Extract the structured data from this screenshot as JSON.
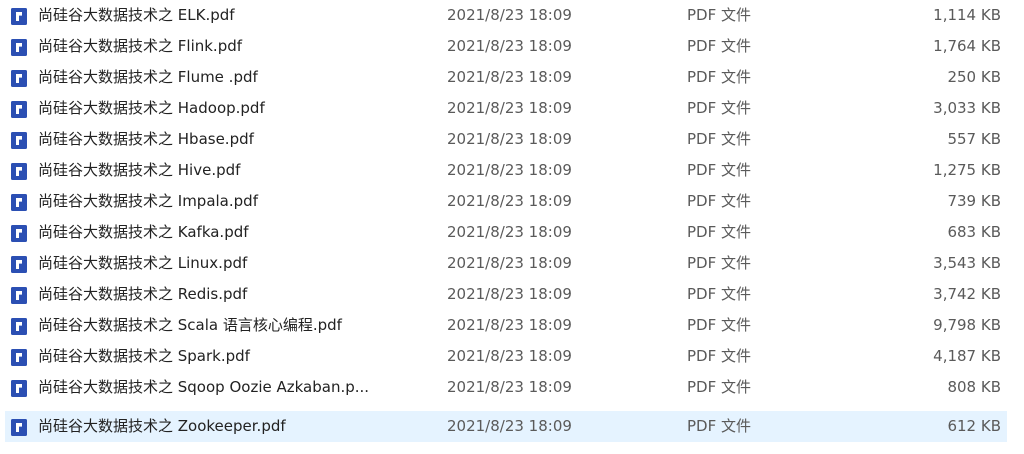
{
  "files": [
    {
      "name": "尚硅谷大数据技术之 ELK.pdf",
      "modified": "2021/8/23 18:09",
      "type": "PDF 文件",
      "size": "1,114 KB",
      "icon": "pdf-file-icon",
      "selected": false
    },
    {
      "name": "尚硅谷大数据技术之 Flink.pdf",
      "modified": "2021/8/23 18:09",
      "type": "PDF 文件",
      "size": "1,764 KB",
      "icon": "pdf-file-icon",
      "selected": false
    },
    {
      "name": "尚硅谷大数据技术之 Flume .pdf",
      "modified": "2021/8/23 18:09",
      "type": "PDF 文件",
      "size": "250 KB",
      "icon": "pdf-file-icon",
      "selected": false
    },
    {
      "name": "尚硅谷大数据技术之 Hadoop.pdf",
      "modified": "2021/8/23 18:09",
      "type": "PDF 文件",
      "size": "3,033 KB",
      "icon": "pdf-file-icon",
      "selected": false
    },
    {
      "name": "尚硅谷大数据技术之 Hbase.pdf",
      "modified": "2021/8/23 18:09",
      "type": "PDF 文件",
      "size": "557 KB",
      "icon": "pdf-file-icon",
      "selected": false
    },
    {
      "name": "尚硅谷大数据技术之 Hive.pdf",
      "modified": "2021/8/23 18:09",
      "type": "PDF 文件",
      "size": "1,275 KB",
      "icon": "pdf-file-icon",
      "selected": false
    },
    {
      "name": "尚硅谷大数据技术之 Impala.pdf",
      "modified": "2021/8/23 18:09",
      "type": "PDF 文件",
      "size": "739 KB",
      "icon": "pdf-file-icon",
      "selected": false
    },
    {
      "name": "尚硅谷大数据技术之 Kafka.pdf",
      "modified": "2021/8/23 18:09",
      "type": "PDF 文件",
      "size": "683 KB",
      "icon": "pdf-file-icon",
      "selected": false
    },
    {
      "name": "尚硅谷大数据技术之 Linux.pdf",
      "modified": "2021/8/23 18:09",
      "type": "PDF 文件",
      "size": "3,543 KB",
      "icon": "pdf-file-icon",
      "selected": false
    },
    {
      "name": "尚硅谷大数据技术之 Redis.pdf",
      "modified": "2021/8/23 18:09",
      "type": "PDF 文件",
      "size": "3,742 KB",
      "icon": "pdf-file-icon",
      "selected": false
    },
    {
      "name": "尚硅谷大数据技术之 Scala 语言核心编程.pdf",
      "modified": "2021/8/23 18:09",
      "type": "PDF 文件",
      "size": "9,798 KB",
      "icon": "pdf-file-icon",
      "selected": false
    },
    {
      "name": "尚硅谷大数据技术之 Spark.pdf",
      "modified": "2021/8/23 18:09",
      "type": "PDF 文件",
      "size": "4,187 KB",
      "icon": "pdf-file-icon",
      "selected": false
    },
    {
      "name": "尚硅谷大数据技术之 Sqoop Oozie Azkaban.p...",
      "modified": "2021/8/23 18:09",
      "type": "PDF 文件",
      "size": "808 KB",
      "icon": "pdf-file-icon",
      "selected": false
    },
    {
      "name": "尚硅谷大数据技术之 Zookeeper.pdf",
      "modified": "2021/8/23 18:09",
      "type": "PDF 文件",
      "size": "612 KB",
      "icon": "pdf-file-icon",
      "selected": true
    }
  ],
  "colors": {
    "icon": "#2b4fb3",
    "selection": "#e5f3ff"
  }
}
